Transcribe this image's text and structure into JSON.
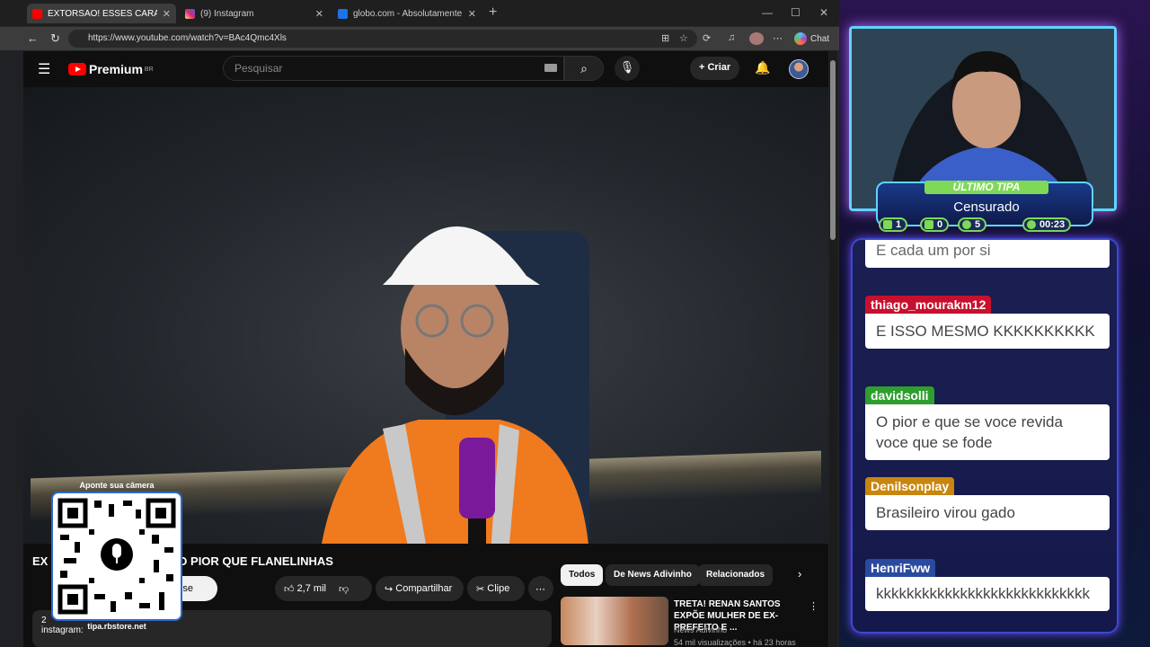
{
  "browser": {
    "tabs": [
      {
        "title": "EXTORSÃO! ESSES CARAS TÃO PIOR",
        "favicon_color": "#ff0000",
        "icon": "youtube-icon",
        "active": true
      },
      {
        "title": "(9) Instagram",
        "favicon_color": "#d62976",
        "icon": "instagram-icon",
        "active": false
      },
      {
        "title": "globo.com - Absolutamente tudo",
        "favicon_color": "#1a73e8",
        "icon": "globo-icon",
        "active": false
      }
    ],
    "url": "https://www.youtube.com/watch?v=BAc4Qmc4Xls",
    "chat_label": "Chat"
  },
  "youtube": {
    "logo_text": "Premium",
    "logo_region": "BR",
    "search_placeholder": "Pesquisar",
    "create_label": "Criar",
    "video_title_visible": "TÃO PIOR QUE FLANELINHAS",
    "video_title_prefix": "EX",
    "subscribe_label_visible": "r-se",
    "likes": "2,7 mil",
    "share_label": "Compartilhar",
    "clip_label": "Clipe",
    "description_line": "instagram:",
    "description_prefix": "2",
    "filter_chips": [
      "Todos",
      "De News Adivinho",
      "Relacionados"
    ],
    "recommended": {
      "title": "TRETA! RENAN SANTOS EXPÕE MULHER DE EX-PREFEITO E ...",
      "channel": "News Adivinho",
      "meta": "54 mil visualizações • há 23 horas"
    }
  },
  "qr_overlay": {
    "caption": "Aponte sua câmera",
    "footer": "tipa.rbstore.net"
  },
  "tipa_panel": {
    "label": "ÚLTIMO TIPA",
    "name": "Censurado",
    "stats": [
      {
        "icon": "chat-bubble-icon",
        "value": "1"
      },
      {
        "icon": "video-icon",
        "value": "0"
      },
      {
        "icon": "refresh-icon",
        "value": "5"
      },
      {
        "icon": "whatsapp-icon",
        "value": "00:23"
      }
    ]
  },
  "chat": {
    "messages": [
      {
        "user": "",
        "text": "E cada um por si",
        "color": "#ffffff"
      },
      {
        "user": "thiago_mourakm12",
        "text": "E ISSO MESMO KKKKKKKKKK",
        "color": "#c8102e"
      },
      {
        "user": "davidsolli",
        "text": "O pior e que se voce revida voce que se fode",
        "color": "#2e9e2e"
      },
      {
        "user": "Denilsonplay",
        "text": "Brasileiro virou gado",
        "color": "#c8860f"
      },
      {
        "user": "HenriFww",
        "text": "kkkkkkkkkkkkkkkkkkkkkkkkkkkk",
        "color": "#2a4aa0"
      }
    ]
  }
}
